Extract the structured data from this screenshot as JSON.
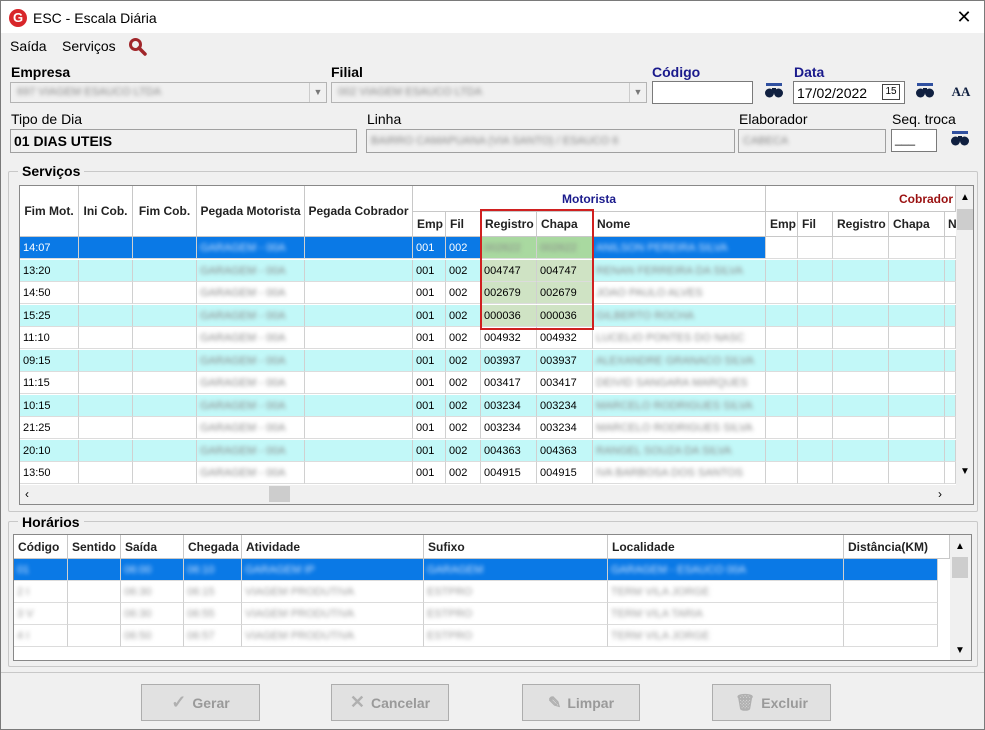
{
  "window": {
    "title": "ESC - Escala Diária",
    "logo_letter": "G"
  },
  "menu": {
    "items": [
      "Saída",
      "Serviços"
    ]
  },
  "fields": {
    "empresa_label": "Empresa",
    "empresa_value": "697 VIAGEM ESAUCO LTDA",
    "filial_label": "Filial",
    "filial_value": "002 VIAGEM ESAUCO LTDA",
    "codigo_label": "Código",
    "codigo_value": "",
    "data_label": "Data",
    "data_value": "17/02/2022",
    "calendar_day": "15",
    "tipo_label": "Tipo de Dia",
    "tipo_value": "01 DIAS UTEIS",
    "linha_label": "Linha",
    "linha_value": "BAIRRO CAMAPUANA (VIA SANTO) / ESAUCO 6",
    "elaborador_label": "Elaborador",
    "elaborador_value": "CABECA",
    "seq_label": "Seq. troca",
    "seq_value": "___"
  },
  "servicos": {
    "title": "Serviços",
    "group_motorista": "Motorista",
    "group_cobrador": "Cobrador",
    "headers": {
      "fim_mot": "Fim Mot.",
      "ini_cob": "Ini Cob.",
      "fim_cob": "Fim Cob.",
      "pegada_motorista": "Pegada Motorista",
      "pegada_cobrador": "Pegada Cobrador",
      "emp": "Emp",
      "fil": "Fil",
      "registro": "Registro",
      "chapa": "Chapa",
      "nome": "Nome",
      "emp2": "Emp",
      "fil2": "Fil",
      "registro2": "Registro",
      "chapa2": "Chapa",
      "n2": "N"
    },
    "rows": [
      {
        "fim_mot": "14:07",
        "pegada": "GARAGEM - 00A",
        "emp": "001",
        "fil": "002",
        "registro": "002622",
        "chapa": "002622",
        "nome": "ANILSON PEREIRA SILVA",
        "selected": true
      },
      {
        "fim_mot": "13:20",
        "pegada": "GARAGEM - 00A",
        "emp": "001",
        "fil": "002",
        "registro": "004747",
        "chapa": "004747",
        "nome": "RENAN FERREIRA DA SILVA"
      },
      {
        "fim_mot": "14:50",
        "pegada": "GARAGEM - 00A",
        "emp": "001",
        "fil": "002",
        "registro": "002679",
        "chapa": "002679",
        "nome": "JOAO PAULO ALVES"
      },
      {
        "fim_mot": "15:25",
        "pegada": "GARAGEM - 00A",
        "emp": "001",
        "fil": "002",
        "registro": "000036",
        "chapa": "000036",
        "nome": "GILBERTO ROCHA"
      },
      {
        "fim_mot": "11:10",
        "pegada": "GARAGEM - 00A",
        "emp": "001",
        "fil": "002",
        "registro": "004932",
        "chapa": "004932",
        "nome": "LUCELIO PONTES DO NASC"
      },
      {
        "fim_mot": "09:15",
        "pegada": "GARAGEM - 00A",
        "emp": "001",
        "fil": "002",
        "registro": "003937",
        "chapa": "003937",
        "nome": "ALEXANDRE GRANACO SILVA"
      },
      {
        "fim_mot": "11:15",
        "pegada": "GARAGEM - 00A",
        "emp": "001",
        "fil": "002",
        "registro": "003417",
        "chapa": "003417",
        "nome": "DEIVID SANGARA MARQUES"
      },
      {
        "fim_mot": "10:15",
        "pegada": "GARAGEM - 00A",
        "emp": "001",
        "fil": "002",
        "registro": "003234",
        "chapa": "003234",
        "nome": "MARCELO RODRIGUES SILVA"
      },
      {
        "fim_mot": "21:25",
        "pegada": "GARAGEM - 00A",
        "emp": "001",
        "fil": "002",
        "registro": "003234",
        "chapa": "003234",
        "nome": "MARCELO RODRIGUES SILVA"
      },
      {
        "fim_mot": "20:10",
        "pegada": "GARAGEM - 00A",
        "emp": "001",
        "fil": "002",
        "registro": "004363",
        "chapa": "004363",
        "nome": "RANGEL SOUZA DA SILVA"
      },
      {
        "fim_mot": "13:50",
        "pegada": "GARAGEM - 00A",
        "emp": "001",
        "fil": "002",
        "registro": "004915",
        "chapa": "004915",
        "nome": "IVA BARBOSA DOS SANTOS"
      }
    ]
  },
  "horarios": {
    "title": "Horários",
    "headers": [
      "Código",
      "Sentido",
      "Saída",
      "Chegada",
      "Atividade",
      "Sufixo",
      "Localidade",
      "Distância(KM)"
    ],
    "rows": [
      [
        "01",
        "06:00",
        "06:10",
        "GARAGEM IP",
        "GARAGEM",
        "GARAGEM - ESAUCO 00A"
      ],
      [
        "2 I",
        "06:30",
        "06:15",
        "VIAGEM PRODUTIVA",
        "ESTPRO",
        "TERM VILA JORGE"
      ],
      [
        "3 V",
        "06:30",
        "06:55",
        "VIAGEM PRODUTIVA",
        "ESTPRO",
        "TERM VILA TARIA"
      ],
      [
        "4 I",
        "06:50",
        "06:57",
        "VIAGEM PRODUTIVA",
        "ESTPRO",
        "TERM VILA JORGE"
      ]
    ]
  },
  "buttons": {
    "gerar": "Gerar",
    "cancelar": "Cancelar",
    "limpar": "Limpar",
    "excluir": "Excluir"
  },
  "colors": {
    "selected": "#0a79e6",
    "alt_row": "#c2f8f8",
    "highlight": "#cfe3c4",
    "highlight_border": "#d02020",
    "label_blue": "#1a1a8c",
    "cobrador_red": "#9a1010"
  }
}
